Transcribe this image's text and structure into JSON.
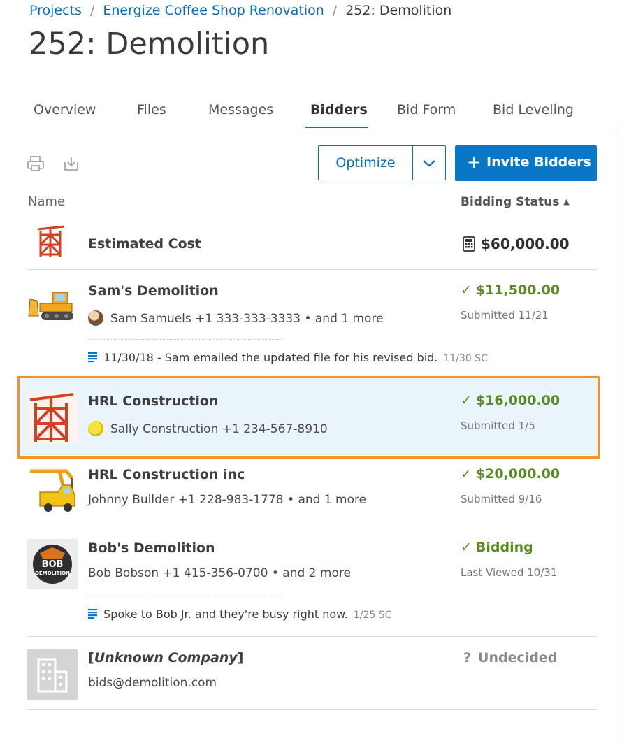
{
  "breadcrumb": {
    "projects": "Projects",
    "project": "Energize Coffee Shop Renovation",
    "current": "252: Demolition",
    "separator": "/"
  },
  "page_title": "252: Demolition",
  "tabs": [
    {
      "label": "Overview"
    },
    {
      "label": "Files"
    },
    {
      "label": "Messages"
    },
    {
      "label": "Bidders",
      "active": true
    },
    {
      "label": "Bid Form"
    },
    {
      "label": "Bid Leveling"
    }
  ],
  "toolbar": {
    "print_icon": "printer-icon",
    "download_icon": "download-icon",
    "optimize_label": "Optimize",
    "invite_plus": "+",
    "invite_label": "Invite Bidders"
  },
  "table": {
    "col_name": "Name",
    "col_status": "Bidding Status",
    "col_status_sort": "▲"
  },
  "estimated": {
    "name": "Estimated Cost",
    "amount": "$60,000.00",
    "icon": "calculator-icon"
  },
  "rows": [
    {
      "company": "Sam's Demolition",
      "contact": "Sam Samuels +1 333-333-3333 • and 1 more",
      "check": "✓",
      "amount": "$11,500.00",
      "sub": "Submitted 11/21",
      "note": "11/30/18 - Sam emailed the updated file for his revised bid.",
      "note_meta": "11/30 SC"
    },
    {
      "company": "HRL Construction",
      "contact": "Sally Construction +1 234-567-8910",
      "check": "✓",
      "amount": "$16,000.00",
      "sub": "Submitted 1/5"
    },
    {
      "company": "HRL Construction inc",
      "contact": "Johnny Builder +1 228-983-1778 • and 1 more",
      "check": "✓",
      "amount": "$20,000.00",
      "sub": "Submitted 9/16"
    },
    {
      "company": "Bob's Demolition",
      "contact": "Bob Bobson +1 415-356-0700 • and 2 more",
      "check": "✓",
      "amount": "Bidding",
      "sub": "Last Viewed 10/31",
      "note": "Spoke to Bob Jr. and they're busy right now.",
      "note_meta": "1/25 SC",
      "logo_text_1": "BOB",
      "logo_text_2": "DEMOLITION"
    },
    {
      "company_open": "[",
      "company": "Unknown Company",
      "company_close": "]",
      "contact": "bids@demolition.com",
      "check": "?",
      "amount": "Undecided"
    }
  ],
  "colors": {
    "accent": "#0a6ebd",
    "button": "#0a76c6",
    "green": "#5a8a26",
    "highlight_border": "#f7941d",
    "highlight_bg": "#eaf4fb",
    "undecided": "#8a8a8a"
  }
}
